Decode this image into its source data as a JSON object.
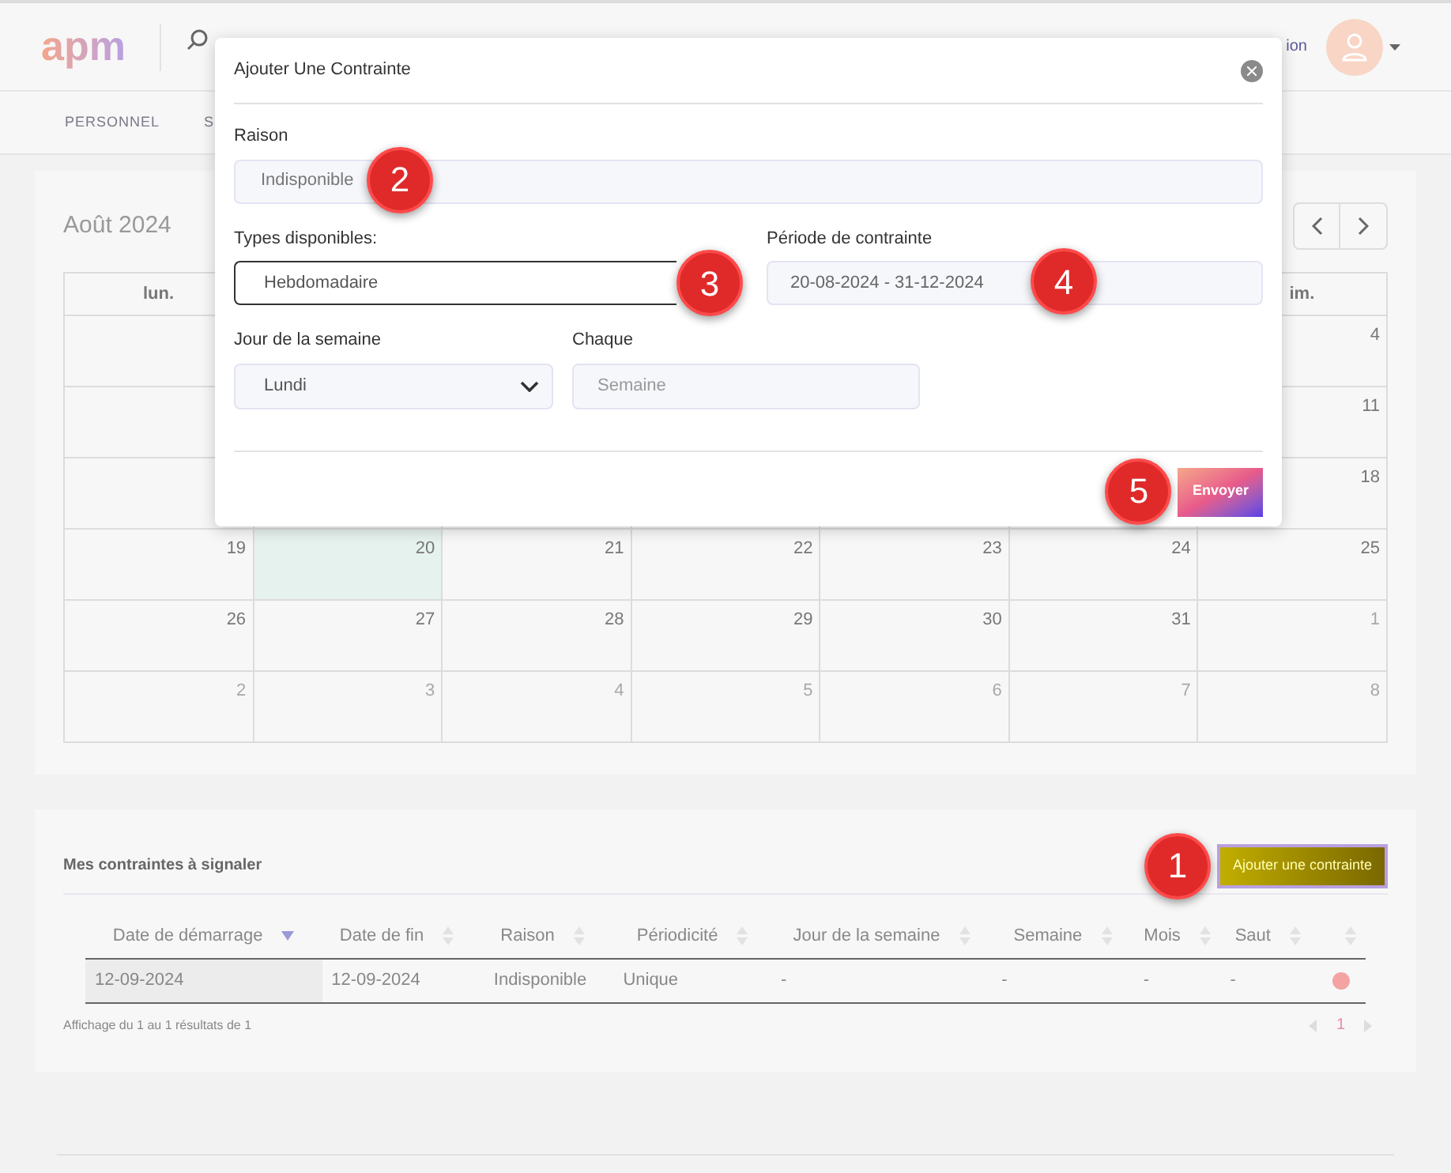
{
  "header": {
    "logo": "apm",
    "menu_text": "ion"
  },
  "nav": {
    "items": [
      {
        "label": "PERSONNEL",
        "selected": false
      },
      {
        "label": "S",
        "selected": false
      }
    ]
  },
  "calendar": {
    "title": "Août 2024",
    "weekdays": [
      "lun.",
      "im."
    ],
    "rows": [
      [
        {},
        {},
        {},
        {},
        {},
        {},
        {
          "day": "4",
          "other_month": false,
          "today": false
        }
      ],
      [
        {},
        {},
        {},
        {},
        {},
        {},
        {
          "day": "11",
          "other_month": false,
          "today": false
        }
      ],
      [
        {},
        {},
        {},
        {},
        {},
        {},
        {
          "day": "18",
          "other_month": false,
          "today": false
        }
      ],
      [
        {
          "day": "19",
          "other_month": false,
          "today": false
        },
        {
          "day": "20",
          "other_month": false,
          "today": true
        },
        {
          "day": "21",
          "other_month": false,
          "today": false
        },
        {
          "day": "22",
          "other_month": false,
          "today": false
        },
        {
          "day": "23",
          "other_month": false,
          "today": false
        },
        {
          "day": "24",
          "other_month": false,
          "today": false
        },
        {
          "day": "25",
          "other_month": false,
          "today": false
        }
      ],
      [
        {
          "day": "26",
          "other_month": false,
          "today": false
        },
        {
          "day": "27",
          "other_month": false,
          "today": false
        },
        {
          "day": "28",
          "other_month": false,
          "today": false
        },
        {
          "day": "29",
          "other_month": false,
          "today": false
        },
        {
          "day": "30",
          "other_month": false,
          "today": false
        },
        {
          "day": "31",
          "other_month": false,
          "today": false
        },
        {
          "day": "1",
          "other_month": true,
          "today": false
        }
      ],
      [
        {
          "day": "2",
          "other_month": true,
          "today": false
        },
        {
          "day": "3",
          "other_month": true,
          "today": false
        },
        {
          "day": "4",
          "other_month": true,
          "today": false
        },
        {
          "day": "5",
          "other_month": true,
          "today": false
        },
        {
          "day": "6",
          "other_month": true,
          "today": false
        },
        {
          "day": "7",
          "other_month": true,
          "today": false
        },
        {
          "day": "8",
          "other_month": true,
          "today": false
        }
      ]
    ]
  },
  "constraints": {
    "title": "Mes contraintes à signaler",
    "add_button": {
      "label": "Ajouter une contrainte",
      "callout": "1"
    },
    "columns": [
      {
        "label": "Date de démarrage",
        "sorted": true
      },
      {
        "label": "Date de fin",
        "sorted": false
      },
      {
        "label": "Raison",
        "sorted": false
      },
      {
        "label": "Périodicité",
        "sorted": false
      },
      {
        "label": "Jour de la semaine",
        "sorted": false
      },
      {
        "label": "Semaine",
        "sorted": false
      },
      {
        "label": "Mois",
        "sorted": false
      },
      {
        "label": "Saut",
        "sorted": false
      },
      {
        "sorted": false
      }
    ],
    "rows": [
      {
        "cells": [
          "12-09-2024",
          "12-09-2024",
          "Indisponible",
          "Unique",
          "-",
          "-",
          "-",
          "-"
        ],
        "color": "#f4a3a3"
      }
    ],
    "footer": "Affichage du 1 au 1 résultats de 1",
    "page": "1"
  },
  "modal": {
    "title": "Ajouter Une Contrainte",
    "raison": {
      "label": "Raison",
      "value": "Indisponible",
      "callout": "2"
    },
    "types": {
      "label": "Types disponibles:",
      "value": "Hebdomadaire",
      "callout": "3",
      "focused": true
    },
    "periode": {
      "label": "Période de contrainte",
      "value": "20-08-2024 - 31-12-2024",
      "callout": "4"
    },
    "jour": {
      "label": "Jour de la semaine",
      "value": "Lundi"
    },
    "chaque": {
      "label": "Chaque",
      "placeholder": "Semaine"
    },
    "submit": {
      "label": "Envoyer",
      "callout": "5"
    }
  }
}
